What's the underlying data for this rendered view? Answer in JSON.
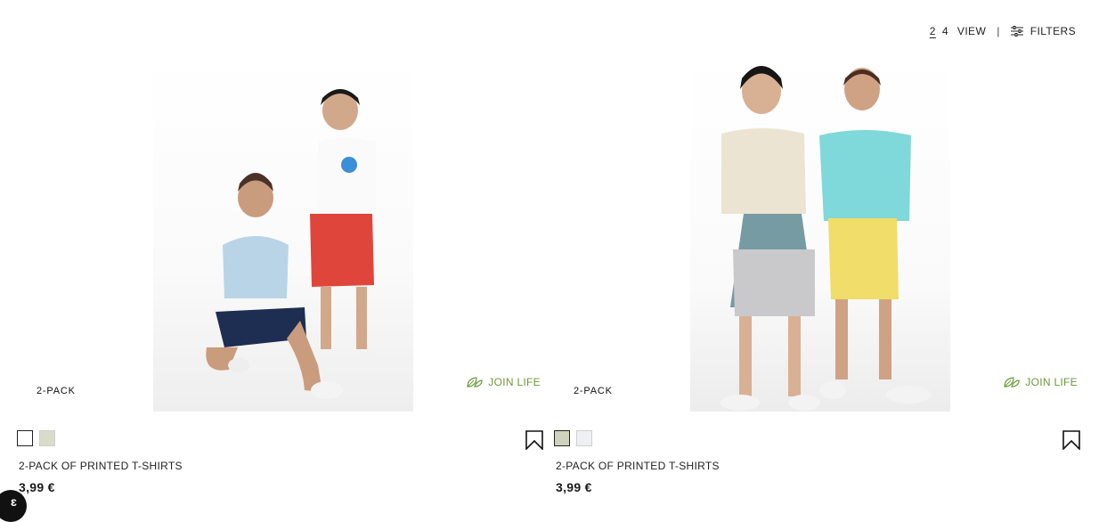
{
  "toolbar": {
    "grid_option_2": "2",
    "grid_option_4": "4",
    "view_label": "VIEW",
    "separator": "|",
    "filters_label": "FILTERS"
  },
  "products": [
    {
      "badge": "2-PACK",
      "join_life": "JOIN LIFE",
      "title": "2-PACK OF PRINTED T-SHIRTS",
      "price": "3,99 €",
      "swatches": [
        {
          "color": "#ffffff",
          "selected": true
        },
        {
          "color": "#d9dccb",
          "selected": false
        }
      ]
    },
    {
      "badge": "2-PACK",
      "join_life": "JOIN LIFE",
      "title": "2-PACK OF PRINTED T-SHIRTS",
      "price": "3,99 €",
      "swatches": [
        {
          "color": "#cfd3bd",
          "selected": true
        },
        {
          "color": "#eef0f4",
          "selected": false
        }
      ]
    }
  ],
  "colors": {
    "join_life_green": "#6a9b3a",
    "text": "#1a1a1a"
  },
  "icons": [
    "filters-icon",
    "leaf-icon",
    "bookmark-icon",
    "chat-icon"
  ]
}
